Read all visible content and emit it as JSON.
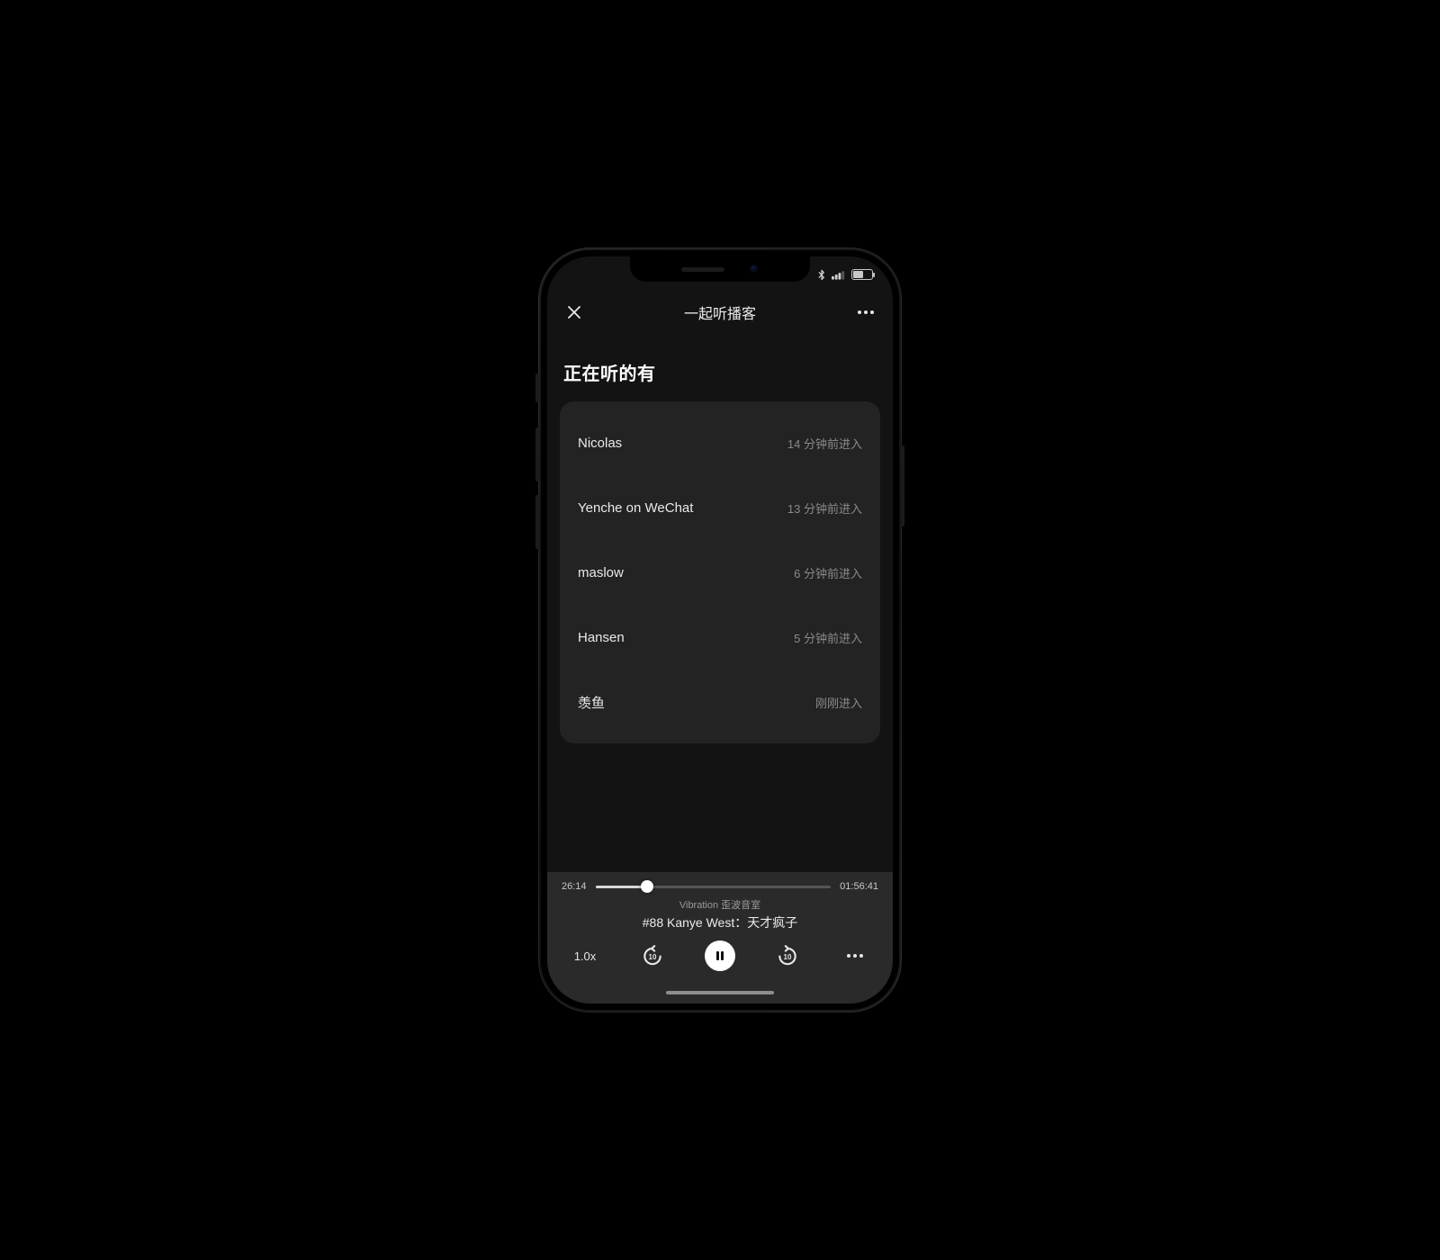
{
  "status": {
    "battery_pct": "49"
  },
  "nav": {
    "title": "一起听播客"
  },
  "section": {
    "title": "正在听的有"
  },
  "listeners": [
    {
      "name": "Nicolas",
      "joined": "14 分钟前进入"
    },
    {
      "name": "Yenche on WeChat",
      "joined": "13 分钟前进入"
    },
    {
      "name": "maslow",
      "joined": "6 分钟前进入"
    },
    {
      "name": "Hansen",
      "joined": "5 分钟前进入"
    },
    {
      "name": "羡鱼",
      "joined": "刚刚进入"
    }
  ],
  "player": {
    "elapsed": "26:14",
    "total": "01:56:41",
    "progress_pct": 22,
    "show": "Vibration 歪波音室",
    "episode": "#88 Kanye West：天才疯子",
    "speed": "1.0x",
    "skip_back": "10",
    "skip_fwd": "10"
  }
}
